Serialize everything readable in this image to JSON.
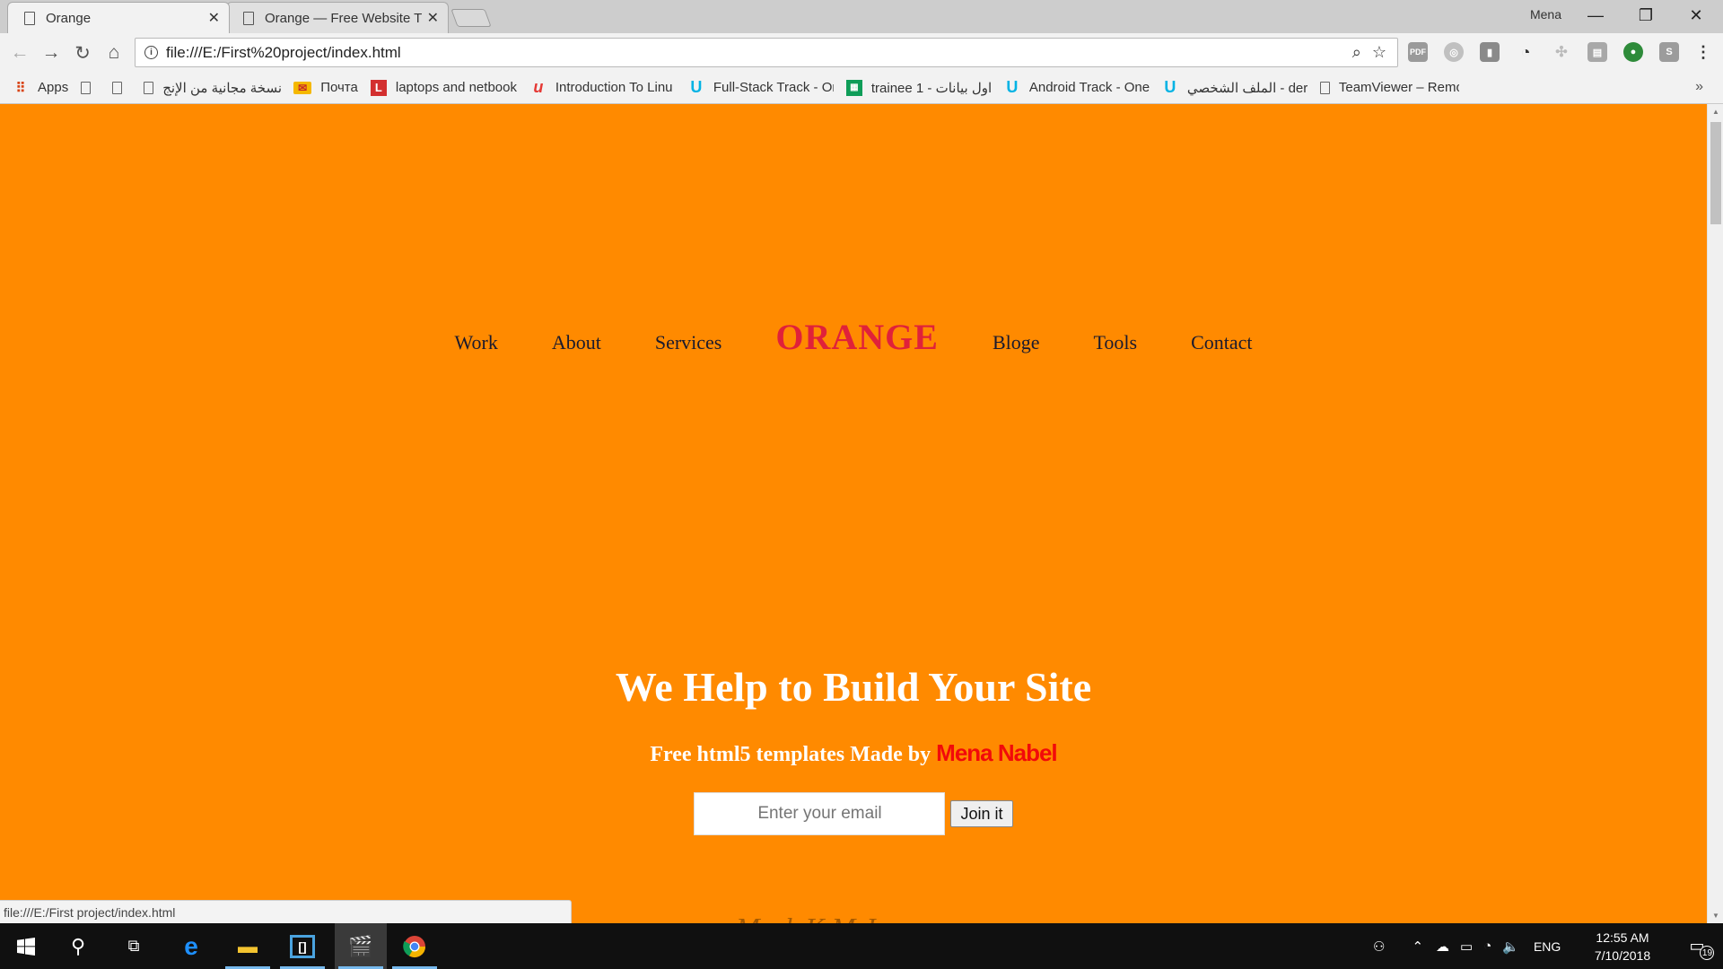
{
  "browser": {
    "profile_name": "Mena",
    "tabs": [
      {
        "title": "Orange",
        "active": true
      },
      {
        "title": "Orange — Free Website T",
        "active": false
      }
    ],
    "address": "file:///E:/First%20project/index.html",
    "bookmarks": [
      {
        "label": "Apps",
        "icon": "apps-grid-icon"
      },
      {
        "label": "",
        "icon": "page-icon"
      },
      {
        "label": "",
        "icon": "page-icon"
      },
      {
        "label": "نسخة مجانية من الإنج",
        "icon": "page-icon"
      },
      {
        "label": "Почта",
        "icon": "mail-icon"
      },
      {
        "label": "laptops and netbook",
        "icon": "l-logo-icon"
      },
      {
        "label": "Introduction To Linu",
        "icon": "udemy-icon"
      },
      {
        "label": "Full-Stack Track - On",
        "icon": "udacity-icon"
      },
      {
        "label": "trainee 1 - اول بيانات",
        "icon": "sheets-icon"
      },
      {
        "label": "Android Track - One",
        "icon": "udacity-icon"
      },
      {
        "label": "الملف الشخصي - ders",
        "icon": "udacity-icon"
      },
      {
        "label": "TeamViewer – Remo",
        "icon": "page-icon"
      }
    ],
    "bookmarks_more": "»",
    "status_url": "file:///E:/First project/index.html"
  },
  "page": {
    "nav_left": [
      "Work",
      "About",
      "Services"
    ],
    "brand": "ORANGE",
    "nav_right": [
      "Bloge",
      "Tools",
      "Contact"
    ],
    "hero_title": "We Help to Build Your Site",
    "hero_sub_prefix": "Free html5 templates Made by ",
    "hero_sub_name": "Mena Nabel",
    "email_placeholder": "Enter your email",
    "join_label": "Join it",
    "partial_footer_text": "Mark K.M.Jr",
    "colors": {
      "background": "#ff8a00",
      "brand": "#e0213a",
      "author": "#f20a0a"
    }
  },
  "taskbar": {
    "language": "ENG",
    "time": "12:55 AM",
    "date": "7/10/2018",
    "notifications_count": "19"
  }
}
